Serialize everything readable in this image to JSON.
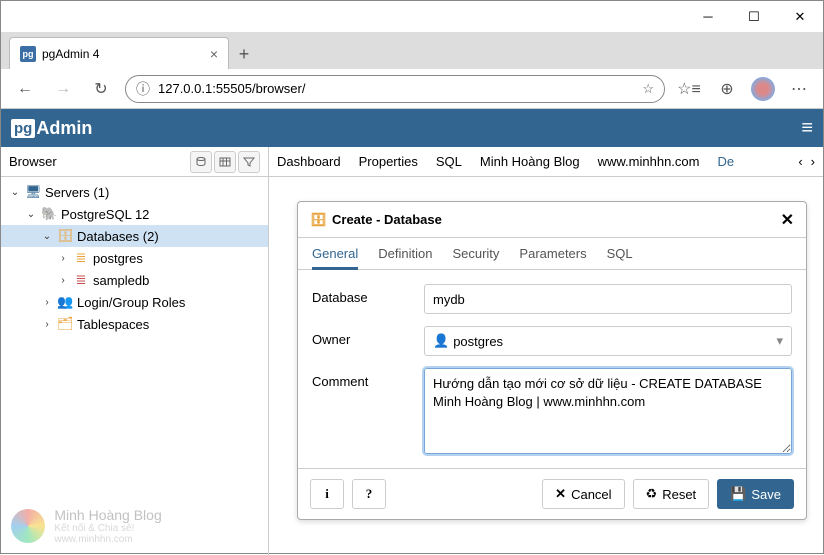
{
  "window": {
    "tab_title": "pgAdmin 4",
    "url": "127.0.0.1:55505/browser/"
  },
  "pgadmin": {
    "logo_prefix": "pg",
    "logo_suffix": "Admin"
  },
  "sidebar": {
    "title": "Browser",
    "tree": {
      "servers": "Servers (1)",
      "pg12": "PostgreSQL 12",
      "databases": "Databases (2)",
      "db_postgres": "postgres",
      "db_sampledb": "sampledb",
      "roles": "Login/Group Roles",
      "tablespaces": "Tablespaces"
    }
  },
  "content_tabs": [
    "Dashboard",
    "Properties",
    "SQL",
    "Minh Hoàng Blog",
    "www.minhhn.com",
    "De"
  ],
  "dialog": {
    "title": "Create - Database",
    "tabs": [
      "General",
      "Definition",
      "Security",
      "Parameters",
      "SQL"
    ],
    "active_tab": 0,
    "labels": {
      "database": "Database",
      "owner": "Owner",
      "comment": "Comment"
    },
    "values": {
      "database": "mydb",
      "owner": "postgres",
      "comment": "Hướng dẫn tạo mới cơ sở dữ liệu - CREATE DATABASE\nMinh Hoàng Blog | www.minhhn.com"
    },
    "buttons": {
      "cancel": "Cancel",
      "reset": "Reset",
      "save": "Save"
    }
  },
  "watermark": {
    "title": "Minh Hoàng Blog",
    "sub": "Kết nối & Chia sẻ!",
    "url": "www.minhhn.com"
  }
}
